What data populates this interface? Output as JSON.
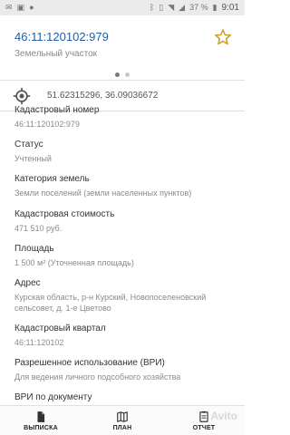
{
  "statusbar": {
    "battery": "37 %",
    "time": "9:01"
  },
  "header": {
    "title": "46:11:120102:979",
    "subtitle": "Земельный участок",
    "pages": 2,
    "active_page": 0
  },
  "coords": {
    "value": "51.62315296, 36.09036672"
  },
  "fields": [
    {
      "label": "Кадастровый номер",
      "value": "46:11:120102:979"
    },
    {
      "label": "Статус",
      "value": "Учтенный"
    },
    {
      "label": "Категория земель",
      "value": "Земли поселений (земли населенных пунктов)"
    },
    {
      "label": "Кадастровая стоимость",
      "value": "471 510 руб."
    },
    {
      "label": "Площадь",
      "value": "1 500 м² (Уточненная площадь)"
    },
    {
      "label": "Адрес",
      "value": "Курская область, р-н Курский, Новопоселеновский сельсовет, д. 1-е Цветово"
    },
    {
      "label": "Кадастровый квартал",
      "value": "46:11:120102"
    },
    {
      "label": "Разрешенное использование (ВРИ)",
      "value": "Для ведения личного подсобного хозяйства"
    },
    {
      "label": "ВРИ по документу",
      "value": ""
    }
  ],
  "tabs": [
    {
      "label": "ВЫПИСКА",
      "icon": "file-icon"
    },
    {
      "label": "ПЛАН",
      "icon": "map-icon"
    },
    {
      "label": "ОТЧЕТ",
      "icon": "report-icon"
    }
  ],
  "watermark": "Avito",
  "colors": {
    "accent": "#1f5ea8",
    "star": "#c9a020"
  }
}
